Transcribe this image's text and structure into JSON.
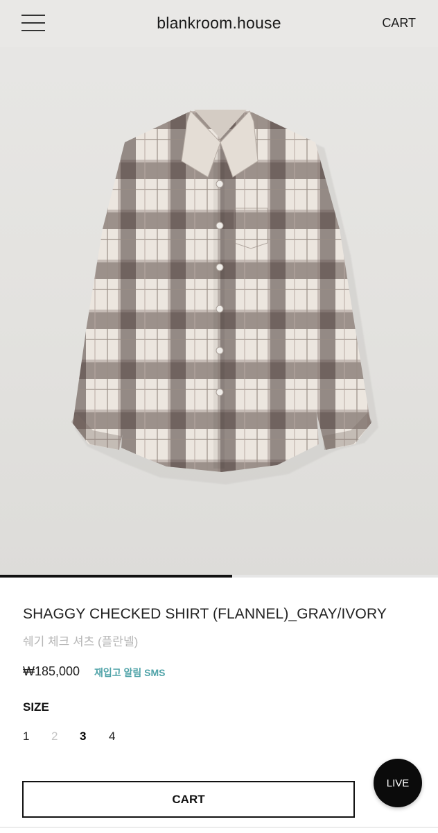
{
  "header": {
    "logo": "blankroom.house",
    "cart_label": "CART",
    "menu_icon": "hamburger-menu-icon"
  },
  "gallery": {
    "image_alt": "Shaggy checked flannel shirt, gray and ivory plaid",
    "progress_fraction": 0.53
  },
  "product": {
    "name": "SHAGGY CHECKED SHIRT (FLANNEL)_GRAY/IVORY",
    "name_kr": "쉐기 체크 셔츠 (플란넬)",
    "price": "₩185,000",
    "restock_label": "재입고 알림 SMS"
  },
  "size": {
    "label": "SIZE",
    "options": [
      {
        "label": "1",
        "status": "available"
      },
      {
        "label": "2",
        "status": "soldout"
      },
      {
        "label": "3",
        "status": "selected"
      },
      {
        "label": "4",
        "status": "available"
      }
    ]
  },
  "cta": {
    "cart_label": "CART"
  },
  "live_badge": {
    "label": "LIVE"
  },
  "colors": {
    "accent": "#4fa3a8",
    "text": "#222222",
    "muted": "#b5b5b5",
    "background": "#e8e7e5"
  }
}
